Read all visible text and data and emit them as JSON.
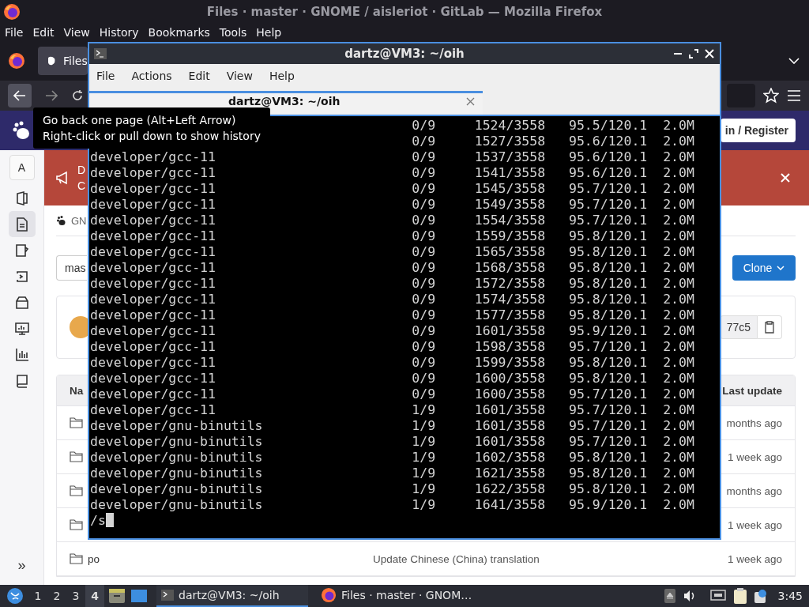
{
  "firefox": {
    "title": "Files · master · GNOME / aisleriot · GitLab — Mozilla Firefox",
    "menu": [
      "File",
      "Edit",
      "View",
      "History",
      "Bookmarks",
      "Tools",
      "Help"
    ],
    "tab": {
      "label": "Files"
    }
  },
  "gitlab": {
    "register_button": "in / Register",
    "sidebar": {
      "avatar": "A",
      "items": [
        {
          "kind": "panel",
          "selected": false
        },
        {
          "kind": "file",
          "selected": true
        },
        {
          "kind": "mug",
          "selected": false
        },
        {
          "kind": "code",
          "selected": false
        },
        {
          "kind": "box",
          "selected": false
        },
        {
          "kind": "monitor",
          "selected": false
        },
        {
          "kind": "chart",
          "selected": false
        },
        {
          "kind": "book",
          "selected": false
        }
      ],
      "expand": "»"
    },
    "banner": {
      "lines": [
        "D",
        "C"
      ]
    },
    "breadcrumb": "GN",
    "branch": "mas",
    "clone": "Clone",
    "commit": {
      "sha": "77c5"
    },
    "table": {
      "columns": [
        "Na",
        "Last update"
      ],
      "rows": [
        {
          "last_update": "months ago"
        },
        {
          "last_update": "1 week ago"
        },
        {
          "last_update": "months ago"
        },
        {
          "last_update": "1 week ago"
        },
        {
          "name": "po",
          "message": "Update Chinese (China) translation",
          "last_update": "1 week ago"
        }
      ]
    }
  },
  "terminal": {
    "title": "dartz@VM3: ~/oih",
    "menu": [
      "File",
      "Actions",
      "Edit",
      "View",
      "Help"
    ],
    "tab": "dartz@VM3: ~/oih",
    "rows": [
      {
        "values": [
          "0/9",
          "1524/3558",
          "95.5/120.1",
          "2.0M"
        ]
      },
      {
        "values": [
          "0/9",
          "1527/3558",
          "95.6/120.1",
          "2.0M"
        ]
      },
      {
        "name": "developer/gcc-11",
        "values": [
          "0/9",
          "1537/3558",
          "95.6/120.1",
          "2.0M"
        ]
      },
      {
        "name": "developer/gcc-11",
        "values": [
          "0/9",
          "1541/3558",
          "95.6/120.1",
          "2.0M"
        ]
      },
      {
        "name": "developer/gcc-11",
        "values": [
          "0/9",
          "1545/3558",
          "95.7/120.1",
          "2.0M"
        ]
      },
      {
        "name": "developer/gcc-11",
        "values": [
          "0/9",
          "1549/3558",
          "95.7/120.1",
          "2.0M"
        ]
      },
      {
        "name": "developer/gcc-11",
        "values": [
          "0/9",
          "1554/3558",
          "95.7/120.1",
          "2.0M"
        ]
      },
      {
        "name": "developer/gcc-11",
        "values": [
          "0/9",
          "1559/3558",
          "95.8/120.1",
          "2.0M"
        ]
      },
      {
        "name": "developer/gcc-11",
        "values": [
          "0/9",
          "1565/3558",
          "95.8/120.1",
          "2.0M"
        ]
      },
      {
        "name": "developer/gcc-11",
        "values": [
          "0/9",
          "1568/3558",
          "95.8/120.1",
          "2.0M"
        ]
      },
      {
        "name": "developer/gcc-11",
        "values": [
          "0/9",
          "1572/3558",
          "95.8/120.1",
          "2.0M"
        ]
      },
      {
        "name": "developer/gcc-11",
        "values": [
          "0/9",
          "1574/3558",
          "95.8/120.1",
          "2.0M"
        ]
      },
      {
        "name": "developer/gcc-11",
        "values": [
          "0/9",
          "1577/3558",
          "95.8/120.1",
          "2.0M"
        ]
      },
      {
        "name": "developer/gcc-11",
        "values": [
          "0/9",
          "1601/3558",
          "95.9/120.1",
          "2.0M"
        ]
      },
      {
        "name": "developer/gcc-11",
        "values": [
          "0/9",
          "1598/3558",
          "95.7/120.1",
          "2.0M"
        ]
      },
      {
        "name": "developer/gcc-11",
        "values": [
          "0/9",
          "1599/3558",
          "95.8/120.1",
          "2.0M"
        ]
      },
      {
        "name": "developer/gcc-11",
        "values": [
          "0/9",
          "1600/3558",
          "95.8/120.1",
          "2.0M"
        ]
      },
      {
        "name": "developer/gcc-11",
        "values": [
          "0/9",
          "1600/3558",
          "95.7/120.1",
          "2.0M"
        ]
      },
      {
        "name": "developer/gcc-11",
        "values": [
          "1/9",
          "1601/3558",
          "95.7/120.1",
          "2.0M"
        ]
      },
      {
        "name": "developer/gnu-binutils",
        "values": [
          "1/9",
          "1601/3558",
          "95.7/120.1",
          "2.0M"
        ]
      },
      {
        "name": "developer/gnu-binutils",
        "values": [
          "1/9",
          "1601/3558",
          "95.7/120.1",
          "2.0M"
        ]
      },
      {
        "name": "developer/gnu-binutils",
        "values": [
          "1/9",
          "1602/3558",
          "95.8/120.1",
          "2.0M"
        ]
      },
      {
        "name": "developer/gnu-binutils",
        "values": [
          "1/9",
          "1621/3558",
          "95.8/120.1",
          "2.0M"
        ]
      },
      {
        "name": "developer/gnu-binutils",
        "values": [
          "1/9",
          "1622/3558",
          "95.8/120.1",
          "2.0M"
        ]
      },
      {
        "name": "developer/gnu-binutils",
        "values": [
          "1/9",
          "1641/3558",
          "95.9/120.1",
          "2.0M"
        ]
      }
    ],
    "prompt": "/s"
  },
  "tooltip": {
    "lines": [
      "Go back one page (Alt+Left Arrow)",
      "Right-click or pull down to show history"
    ]
  },
  "taskbar": {
    "workspaces": [
      {
        "label": "1",
        "selected": false
      },
      {
        "label": "2",
        "selected": false
      },
      {
        "label": "3",
        "selected": false
      },
      {
        "label": "4",
        "selected": true
      }
    ],
    "tasks": [
      {
        "kind": "terminal",
        "label": "dartz@VM3: ~/oih",
        "selected": true
      },
      {
        "kind": "firefox",
        "label": "Files · master · GNOM…",
        "selected": false
      }
    ],
    "clock": "3:45"
  }
}
